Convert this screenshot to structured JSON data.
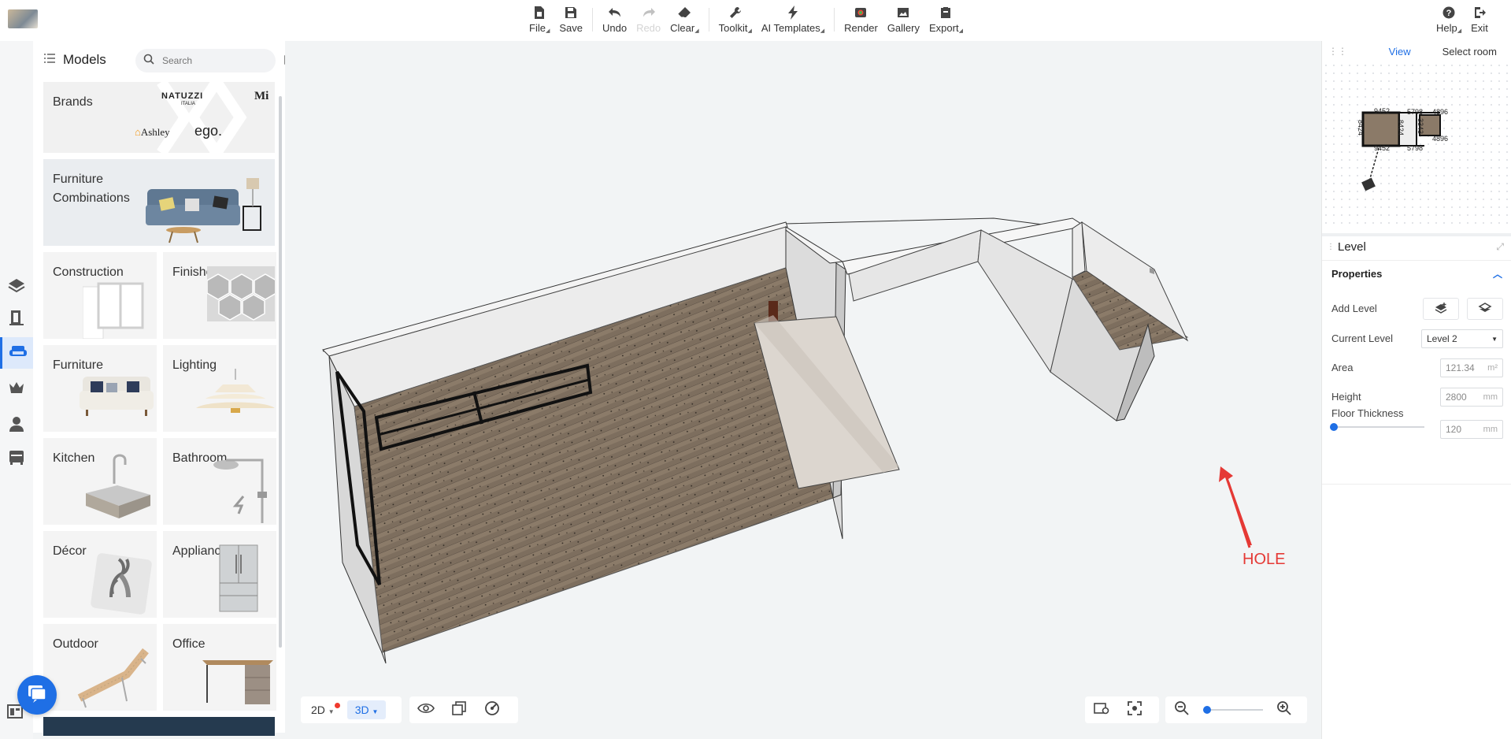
{
  "toolbar": {
    "file": "File",
    "save": "Save",
    "undo": "Undo",
    "redo": "Redo",
    "clear": "Clear",
    "toolkit": "Toolkit",
    "ai_templates": "AI Templates",
    "render": "Render",
    "gallery": "Gallery",
    "export": "Export",
    "help": "Help",
    "exit": "Exit"
  },
  "models_panel": {
    "title": "Models",
    "search_placeholder": "Search",
    "brands": {
      "label": "Brands",
      "logos": [
        "NATUZZI",
        "ITALIA",
        "Mi",
        "Ashley",
        "ego."
      ]
    },
    "furniture_combinations": "Furniture Combinations",
    "categories": [
      {
        "label": "Construction"
      },
      {
        "label": "Finishes"
      },
      {
        "label": "Furniture"
      },
      {
        "label": "Lighting"
      },
      {
        "label": "Kitchen"
      },
      {
        "label": "Bathroom"
      },
      {
        "label": "Décor"
      },
      {
        "label": "Appliance"
      },
      {
        "label": "Outdoor"
      },
      {
        "label": "Office"
      }
    ]
  },
  "canvas": {
    "annotation": "HOLE",
    "annotation_color": "#e53935"
  },
  "view_controls": {
    "mode_2d": "2D",
    "mode_3d": "3D",
    "active_mode": "3D"
  },
  "zoom": {
    "level": 0.0
  },
  "right_panel": {
    "tabs": [
      {
        "label": "View",
        "active": true
      },
      {
        "label": "Select room",
        "active": false
      }
    ],
    "minimap_dims": [
      "9452",
      "5798",
      "4896",
      "8424",
      "8424",
      "3343",
      "9452",
      "5798",
      "4896"
    ],
    "level_title": "Level",
    "properties_title": "Properties",
    "add_level": "Add Level",
    "current_level_label": "Current Level",
    "current_level_value": "Level 2",
    "area_label": "Area",
    "area_value": "121.34",
    "area_unit": "m²",
    "height_label": "Height",
    "height_value": "2800",
    "height_unit": "mm",
    "floor_thickness_label": "Floor Thickness",
    "floor_thickness_value": "120",
    "floor_thickness_unit": "mm"
  },
  "colors": {
    "accent": "#1f6fe5",
    "alert": "#f03a2e"
  }
}
